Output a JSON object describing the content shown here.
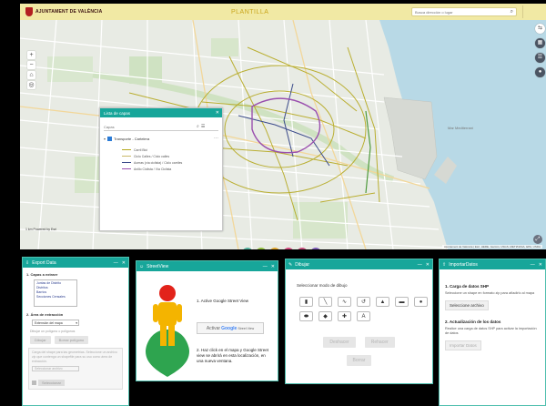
{
  "app": {
    "logo_text": "AJUNTAMENT DE VALÈNCIA",
    "title": "PLANTILLA",
    "search_placeholder": "Busca dirección o lugar",
    "zoom_in": "+",
    "zoom_out": "−",
    "scale_text": "1 km     Powered by Esri",
    "attribution": "Ajuntament de València | Esri, HERE, Garmin, USGS, METI/NASA, EPA, USDA"
  },
  "layers_panel": {
    "title": "Lista de capas",
    "filter_placeholder": "Capas",
    "group_label": "Transporte - Cartelera",
    "legend": [
      {
        "label": "Carril Bici",
        "color": "#b5a81e"
      },
      {
        "label": "Ciclo Calles / Ciclo calles",
        "color": "#c9b96a"
      },
      {
        "label": "Aceras (vía ciclista) / Ciclo carriles",
        "color": "#3a4a8a"
      },
      {
        "label": "Anillo Ciclista / Vía Ciclista",
        "color": "#9a4fae"
      }
    ]
  },
  "tool_buttons": [
    {
      "color": "#4fb19d",
      "icon": "layers-icon"
    },
    {
      "color": "#8fbf3a",
      "icon": "draw-icon"
    },
    {
      "color": "#e0a52c",
      "icon": "measure-icon"
    },
    {
      "color": "#d5467f",
      "icon": "streetview-icon"
    },
    {
      "color": "#c44a7a",
      "icon": "export-icon"
    },
    {
      "color": "#7d5ab8",
      "icon": "import-icon"
    }
  ],
  "export_panel": {
    "title": "Export Data",
    "sec1": "1. Capas a extraer",
    "layer_options": [
      "Juntas de Distrito",
      "Distritos",
      "Barrios",
      "Secciones Censales"
    ],
    "sec2": "2. Área de extracción",
    "area_value": "Extensión del mapa",
    "hint": "Dibujar un polígono o polígonos",
    "btn_draw": "Dibujar",
    "btn_clear": "Borrar polígono",
    "grey_text": "Carga del shape para las geometrías. Seleccione un archivo zip que contenga un shapefile para su uso como área de extracción.",
    "file_select": "Seleccionar archivo",
    "btn_select": "Seleccionar"
  },
  "streetview_panel": {
    "title": "StreetView",
    "step1": "1. Active Google Street View",
    "btn_activate": "Activar",
    "btn_brand": "Google",
    "btn_suffix": "Street View",
    "step2": "2. Haz click en el mapa y Google Street view se abrirá en esta localización, en una nueva ventana."
  },
  "draw_panel": {
    "title": "Dibujar",
    "label": "Seleccionar modo de dibujo",
    "tools": [
      "▮",
      "╲",
      "∿",
      "↺",
      "▲",
      "▬",
      "●",
      "⬬",
      "◆",
      "✚",
      "A"
    ],
    "btn_undo": "Deshacer",
    "btn_redo": "Rehacer",
    "btn_clear": "Borrar"
  },
  "import_panel": {
    "title": "ImportarDatos",
    "sec1": "1. Carga de datos SHP",
    "desc1": "Seleccione un shape en formato zip para añadirlo al mapa",
    "btn_file": "Seleccione archivo",
    "sec2": "2. Actualización de los datos",
    "desc2": "Realice una carga de datos SHP para activar la importación de datos",
    "btn_import": "Importar Datos"
  }
}
